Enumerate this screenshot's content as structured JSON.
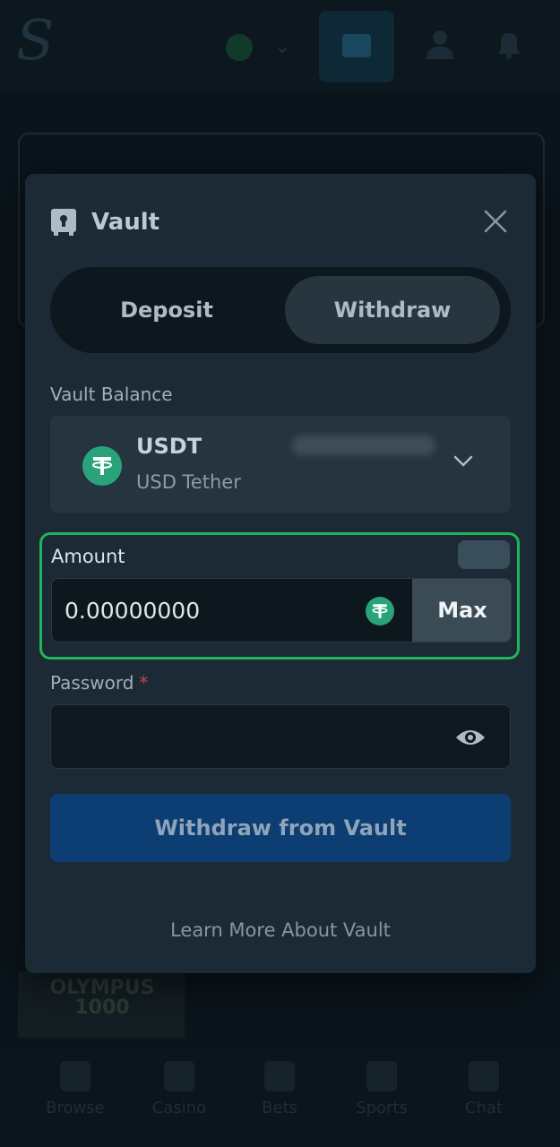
{
  "background": {
    "logo": "S",
    "banner_text": "OLYMPUS 1000",
    "nav": [
      "Browse",
      "Casino",
      "Bets",
      "Sports",
      "Chat"
    ]
  },
  "modal": {
    "title": "Vault",
    "tabs": [
      {
        "label": "Deposit",
        "active": false
      },
      {
        "label": "Withdraw",
        "active": true
      }
    ],
    "vault_balance_label": "Vault Balance",
    "currency": {
      "symbol": "USDT",
      "name": "USD Tether",
      "icon": "tether-icon"
    },
    "amount": {
      "label": "Amount",
      "value": "0.00000000",
      "max_label": "Max"
    },
    "password": {
      "label": "Password",
      "required_marker": "*",
      "value": ""
    },
    "submit_label": "Withdraw from Vault",
    "learn_more_label": "Learn More About Vault"
  },
  "colors": {
    "highlight": "#1fb65a",
    "tether": "#2aa37a",
    "primary_button": "#0c3d73",
    "required": "#c4474f"
  }
}
